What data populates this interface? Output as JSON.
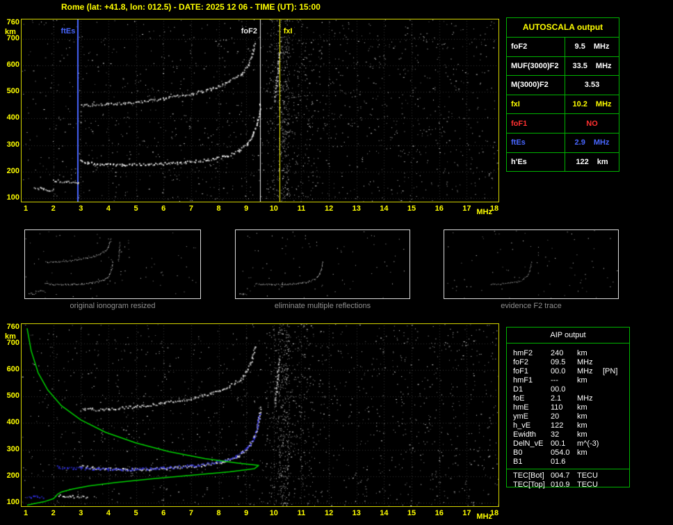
{
  "title": "Rome (lat: +41.8, lon: 012.5) - DATE: 2025 12 06 - TIME (UT): 15:00",
  "colors": {
    "accent_yellow": "#ffff00",
    "grid_green": "#00b400",
    "text_white": "#ffffff",
    "alert_red": "#ff3030",
    "es_blue": "#4866ff",
    "restored_blue": "#3333ee",
    "profile_green": "#00d000",
    "caption_gray": "#8f8f8f"
  },
  "autoscala_table": {
    "header": "AUTOSCALA output",
    "rows": [
      {
        "param": "foF2",
        "value": "9.5",
        "unit": "MHz",
        "color": "#ffffff"
      },
      {
        "param": "MUF(3000)F2",
        "value": "33.5",
        "unit": "MHz",
        "color": "#ffffff"
      },
      {
        "param": "M(3000)F2",
        "value": "3.53",
        "unit": "",
        "color": "#ffffff"
      },
      {
        "param": "fxI",
        "value": "10.2",
        "unit": "MHz",
        "color": "#ffff00"
      },
      {
        "param": "foF1",
        "value": "NO",
        "unit": "",
        "color": "#ff3030"
      },
      {
        "param": "ftEs",
        "value": "2.9",
        "unit": "MHz",
        "color": "#4866ff"
      },
      {
        "param": "h'Es",
        "value": "122",
        "unit": "km",
        "color": "#ffffff"
      }
    ]
  },
  "aip_table": {
    "header": "AIP output",
    "rows": [
      {
        "param": "hmF2",
        "value": "240",
        "unit": "km",
        "extra": ""
      },
      {
        "param": "foF2",
        "value": "09.5",
        "unit": "MHz",
        "extra": ""
      },
      {
        "param": "foF1",
        "value": "00.0",
        "unit": "MHz",
        "extra": "[PN]"
      },
      {
        "param": "hmF1",
        "value": "---",
        "unit": "km",
        "extra": ""
      },
      {
        "param": "D1",
        "value": "00.0",
        "unit": "",
        "extra": ""
      },
      {
        "param": "foE",
        "value": "2.1",
        "unit": "MHz",
        "extra": ""
      },
      {
        "param": "hmE",
        "value": "110",
        "unit": "km",
        "extra": ""
      },
      {
        "param": "ymE",
        "value": "20",
        "unit": "km",
        "extra": ""
      },
      {
        "param": "h_vE",
        "value": "122",
        "unit": "km",
        "extra": ""
      },
      {
        "param": "Ewidth",
        "value": "32",
        "unit": "km",
        "extra": ""
      },
      {
        "param": "DelN_vE",
        "value": "00.1",
        "unit": "m^(-3)",
        "extra": ""
      },
      {
        "param": "B0",
        "value": "054.0",
        "unit": "km",
        "extra": ""
      },
      {
        "param": "B1",
        "value": "01.6",
        "unit": "",
        "extra": ""
      }
    ],
    "tec_rows": [
      {
        "param": "TEC[Bot]",
        "value": "004.7",
        "unit": "TECU"
      },
      {
        "param": "TEC[Top]",
        "value": "010.9",
        "unit": "TECU"
      }
    ]
  },
  "thumbnails": [
    {
      "caption": "original ionogram resized",
      "trace_indices": [
        0,
        1,
        2,
        3,
        4
      ],
      "min_f": 1,
      "dim": false
    },
    {
      "caption": "eliminate multiple reflections",
      "trace_indices": [
        0,
        2
      ],
      "min_f": 1,
      "dim": false
    },
    {
      "caption": "evidence F2 trace",
      "trace_indices": [
        2
      ],
      "min_f": 4.6,
      "dim": true
    }
  ],
  "chart_data": [
    {
      "id": "top",
      "type": "scatter",
      "xlabel": "MHz",
      "ylabel": "km",
      "xlim": [
        1,
        18
      ],
      "ylim": [
        100,
        760
      ],
      "x_ticks": [
        1,
        2,
        3,
        4,
        5,
        6,
        7,
        8,
        9,
        10,
        11,
        12,
        13,
        14,
        15,
        16,
        17,
        18
      ],
      "y_ticks": [
        760,
        700,
        600,
        500,
        400,
        300,
        200,
        100
      ],
      "grid": "dotted",
      "noise_seed": 7,
      "markers": [
        {
          "label": "ftEs",
          "f": 2.9,
          "color": "#4866ff",
          "width": 2,
          "align": "right"
        },
        {
          "label": "foF2",
          "f": 9.5,
          "color": "#e8e8e8",
          "width": 1,
          "align": "right"
        },
        {
          "label": "fxI",
          "f": 10.2,
          "color": "#ffff00",
          "width": 1,
          "align": "left"
        }
      ],
      "traces": [
        {
          "name": "Es-trace",
          "color": "#f0f0f0",
          "style": "speckle",
          "points": [
            [
              1.3,
              140
            ],
            [
              1.65,
              135
            ],
            [
              2.0,
              132
            ]
          ]
        },
        {
          "name": "Es-second",
          "color": "#d8d8d8",
          "style": "speckle",
          "points": [
            [
              2.0,
              168
            ],
            [
              2.45,
              161
            ],
            [
              2.9,
              157
            ]
          ]
        },
        {
          "name": "F2-trace",
          "color": "#ffffff",
          "style": "speckle",
          "points": [
            [
              2.95,
              240
            ],
            [
              3.5,
              231
            ],
            [
              4.5,
              226
            ],
            [
              5.5,
              228
            ],
            [
              6.5,
              234
            ],
            [
              7.5,
              244
            ],
            [
              8.2,
              258
            ],
            [
              8.7,
              278
            ],
            [
              9.0,
              302
            ],
            [
              9.2,
              334
            ],
            [
              9.35,
              374
            ],
            [
              9.45,
              420
            ],
            [
              9.5,
              458
            ]
          ]
        },
        {
          "name": "F2-second-hop",
          "color": "#e0e0e0",
          "style": "speckle",
          "points": [
            [
              3.0,
              452
            ],
            [
              4.0,
              456
            ],
            [
              5.0,
              464
            ],
            [
              6.0,
              477
            ],
            [
              7.0,
              495
            ],
            [
              7.7,
              513
            ],
            [
              8.3,
              538
            ],
            [
              8.8,
              569
            ],
            [
              9.05,
              603
            ],
            [
              9.2,
              643
            ],
            [
              9.3,
              690
            ]
          ]
        },
        {
          "name": "F2-x-mode-tail",
          "color": "#c8c8c8",
          "style": "speckle",
          "points": [
            [
              10.02,
              470
            ],
            [
              10.08,
              525
            ],
            [
              10.13,
              585
            ],
            [
              10.17,
              650
            ]
          ]
        }
      ]
    },
    {
      "id": "bottom",
      "type": "scatter",
      "xlabel": "MHz",
      "ylabel": "km",
      "xlim": [
        1,
        18
      ],
      "ylim": [
        100,
        760
      ],
      "x_ticks": [
        1,
        2,
        3,
        4,
        5,
        6,
        7,
        8,
        9,
        10,
        11,
        12,
        13,
        14,
        15,
        16,
        17,
        18
      ],
      "y_ticks": [
        760,
        700,
        600,
        500,
        400,
        300,
        200,
        100
      ],
      "grid": "dotted",
      "noise_seed": 13,
      "markers": [],
      "traces": [
        {
          "name": "Es-trace",
          "color": "#f0f0f0",
          "style": "speckle",
          "points": [
            [
              2.2,
              128
            ],
            [
              2.7,
              124
            ],
            [
              3.2,
              122
            ]
          ]
        },
        {
          "name": "F2-trace",
          "color": "#ffffff",
          "style": "speckle",
          "points": [
            [
              2.95,
              240
            ],
            [
              3.5,
              231
            ],
            [
              4.5,
              226
            ],
            [
              5.5,
              228
            ],
            [
              6.5,
              234
            ],
            [
              7.5,
              244
            ],
            [
              8.2,
              258
            ],
            [
              8.7,
              278
            ],
            [
              9.0,
              302
            ],
            [
              9.2,
              334
            ],
            [
              9.35,
              374
            ],
            [
              9.45,
              420
            ],
            [
              9.5,
              458
            ]
          ]
        },
        {
          "name": "F2-second-hop",
          "color": "#e0e0e0",
          "style": "speckle",
          "points": [
            [
              3.0,
              452
            ],
            [
              4.0,
              456
            ],
            [
              5.0,
              464
            ],
            [
              6.0,
              477
            ],
            [
              7.0,
              495
            ],
            [
              7.7,
              513
            ],
            [
              8.3,
              538
            ],
            [
              8.8,
              569
            ],
            [
              9.05,
              603
            ],
            [
              9.2,
              643
            ],
            [
              9.3,
              690
            ]
          ]
        },
        {
          "name": "F2-x-mode-tail",
          "color": "#c8c8c8",
          "style": "speckle",
          "points": [
            [
              10.02,
              470
            ],
            [
              10.08,
              525
            ],
            [
              10.13,
              585
            ],
            [
              10.17,
              650
            ]
          ]
        },
        {
          "name": "restored-trace",
          "color": "#3333ee",
          "style": "speckle",
          "points": [
            [
              2.1,
              236
            ],
            [
              3.0,
              230
            ],
            [
              4.0,
              227
            ],
            [
              5.0,
              228
            ],
            [
              6.0,
              233
            ],
            [
              7.0,
              240
            ],
            [
              8.0,
              256
            ],
            [
              8.6,
              276
            ],
            [
              9.0,
              304
            ],
            [
              9.25,
              344
            ],
            [
              9.4,
              394
            ],
            [
              9.46,
              434
            ]
          ]
        },
        {
          "name": "restored-Es",
          "color": "#3333ee",
          "style": "speckle",
          "points": [
            [
              1.02,
              126
            ],
            [
              1.3,
              123
            ],
            [
              1.6,
              121
            ]
          ]
        },
        {
          "name": "electron-density-profile",
          "color": "#00d000",
          "style": "line",
          "points": [
            [
              1.05,
              758
            ],
            [
              1.2,
              672
            ],
            [
              1.45,
              590
            ],
            [
              1.8,
              525
            ],
            [
              2.3,
              465
            ],
            [
              3.0,
              412
            ],
            [
              3.9,
              365
            ],
            [
              5.0,
              325
            ],
            [
              6.2,
              292
            ],
            [
              7.5,
              266
            ],
            [
              8.7,
              249
            ],
            [
              9.45,
              240
            ],
            [
              9.3,
              228
            ],
            [
              8.4,
              216
            ],
            [
              7.0,
              203
            ],
            [
              5.6,
              190
            ],
            [
              4.3,
              176
            ],
            [
              3.3,
              163
            ],
            [
              2.7,
              151
            ],
            [
              2.3,
              140
            ],
            [
              2.15,
              131
            ],
            [
              2.1,
              124
            ],
            [
              2.0,
              114
            ],
            [
              1.7,
              104
            ],
            [
              1.3,
              96
            ],
            [
              1.05,
              90
            ]
          ]
        }
      ]
    }
  ]
}
